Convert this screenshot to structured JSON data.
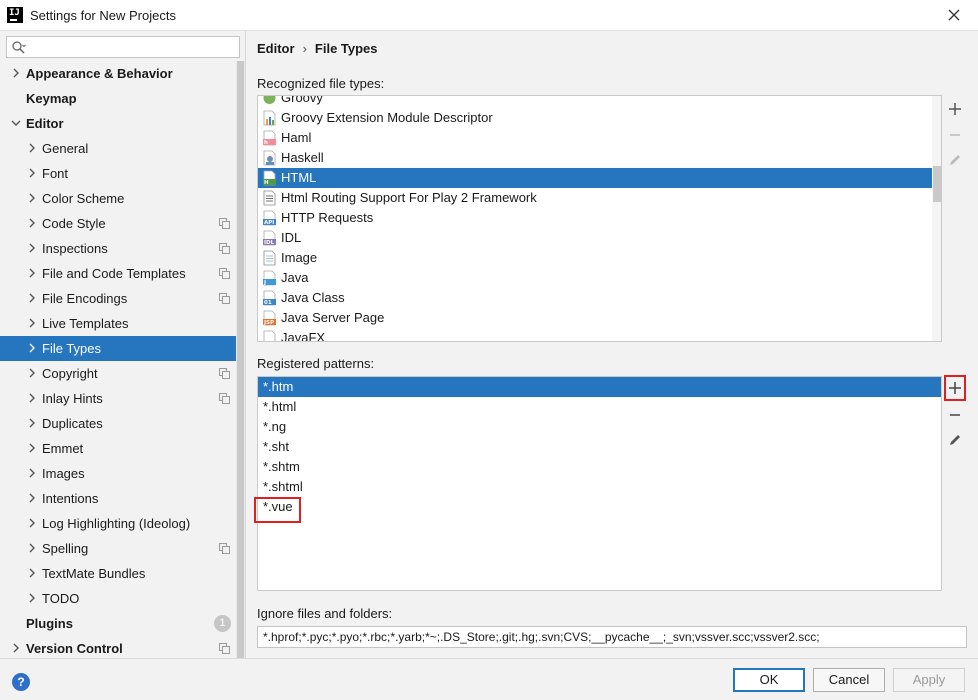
{
  "window": {
    "title": "Settings for New Projects",
    "logo_text": "IJ"
  },
  "search": {
    "placeholder": ""
  },
  "tree": [
    {
      "label": "Appearance & Behavior",
      "level": 0,
      "bold": true,
      "chevron": "right"
    },
    {
      "label": "Keymap",
      "level": 0,
      "bold": true,
      "chevron": "none"
    },
    {
      "label": "Editor",
      "level": 0,
      "bold": true,
      "chevron": "down"
    },
    {
      "label": "General",
      "level": 1,
      "chevron": "right"
    },
    {
      "label": "Font",
      "level": 1,
      "chevron": "right"
    },
    {
      "label": "Color Scheme",
      "level": 1,
      "chevron": "right"
    },
    {
      "label": "Code Style",
      "level": 1,
      "chevron": "right",
      "copy": true
    },
    {
      "label": "Inspections",
      "level": 1,
      "chevron": "right",
      "copy": true
    },
    {
      "label": "File and Code Templates",
      "level": 1,
      "chevron": "right",
      "copy": true
    },
    {
      "label": "File Encodings",
      "level": 1,
      "chevron": "right",
      "copy": true
    },
    {
      "label": "Live Templates",
      "level": 1,
      "chevron": "right"
    },
    {
      "label": "File Types",
      "level": 1,
      "chevron": "right",
      "selected": true
    },
    {
      "label": "Copyright",
      "level": 1,
      "chevron": "right",
      "copy": true
    },
    {
      "label": "Inlay Hints",
      "level": 1,
      "chevron": "right",
      "copy": true
    },
    {
      "label": "Duplicates",
      "level": 1,
      "chevron": "right"
    },
    {
      "label": "Emmet",
      "level": 1,
      "chevron": "right"
    },
    {
      "label": "Images",
      "level": 1,
      "chevron": "right"
    },
    {
      "label": "Intentions",
      "level": 1,
      "chevron": "right"
    },
    {
      "label": "Log Highlighting (Ideolog)",
      "level": 1,
      "chevron": "right"
    },
    {
      "label": "Spelling",
      "level": 1,
      "chevron": "right",
      "copy": true
    },
    {
      "label": "TextMate Bundles",
      "level": 1,
      "chevron": "right"
    },
    {
      "label": "TODO",
      "level": 1,
      "chevron": "right"
    },
    {
      "label": "Plugins",
      "level": 0,
      "bold": true,
      "chevron": "none",
      "badge": "1"
    },
    {
      "label": "Version Control",
      "level": 0,
      "bold": true,
      "chevron": "right",
      "copy": true
    }
  ],
  "breadcrumb": {
    "parent": "Editor",
    "separator": "›",
    "current": "File Types"
  },
  "recognized": {
    "label": "Recognized file types:",
    "items": [
      {
        "label": "Groovy",
        "icon": "groovy-icon"
      },
      {
        "label": "Groovy Extension Module Descriptor",
        "icon": "descriptor-icon"
      },
      {
        "label": "Haml",
        "icon": "haml-icon"
      },
      {
        "label": "Haskell",
        "icon": "haskell-icon"
      },
      {
        "label": "HTML",
        "icon": "html-icon",
        "selected": true
      },
      {
        "label": "Html Routing Support For Play 2 Framework",
        "icon": "text-file-icon"
      },
      {
        "label": "HTTP Requests",
        "icon": "api-icon"
      },
      {
        "label": "IDL",
        "icon": "idl-icon"
      },
      {
        "label": "Image",
        "icon": "image-file-icon"
      },
      {
        "label": "Java",
        "icon": "java-icon"
      },
      {
        "label": "Java Class",
        "icon": "java-class-icon"
      },
      {
        "label": "Java Server Page",
        "icon": "jsp-icon"
      },
      {
        "label": "JavaFX",
        "icon": "javafx-icon"
      }
    ]
  },
  "patterns": {
    "label": "Registered patterns:",
    "items": [
      {
        "label": "*.htm",
        "selected": true
      },
      {
        "label": "*.html"
      },
      {
        "label": "*.ng"
      },
      {
        "label": "*.sht"
      },
      {
        "label": "*.shtm"
      },
      {
        "label": "*.shtml"
      },
      {
        "label": "*.vue"
      }
    ]
  },
  "ignore": {
    "label": "Ignore files and folders:",
    "value": "*.hprof;*.pyc;*.pyo;*.rbc;*.yarb;*~;.DS_Store;.git;.hg;.svn;CVS;__pycache__;_svn;vssver.scc;vssver2.scc;"
  },
  "buttons": {
    "ok": "OK",
    "cancel": "Cancel",
    "apply": "Apply",
    "help": "?"
  },
  "colors": {
    "selection": "#2675bf",
    "highlight": "#e0201e",
    "help": "#2f6fc9"
  }
}
